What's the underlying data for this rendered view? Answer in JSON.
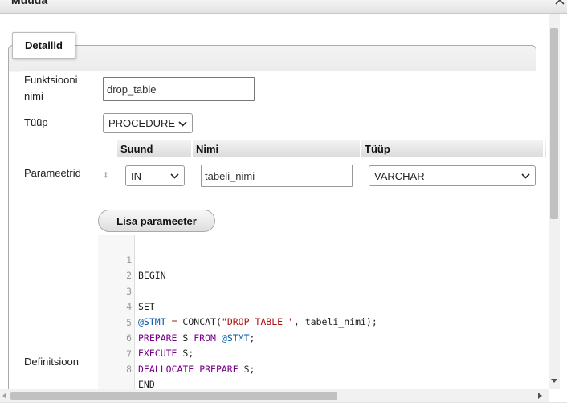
{
  "dialog": {
    "title": "Muuda"
  },
  "fieldset": {
    "legend": "Detailid"
  },
  "form": {
    "name_label_line1": "Funktsiooni",
    "name_label_line2": "nimi",
    "name_value": "drop_table",
    "type_label": "Tüüp",
    "type_value": "PROCEDURE",
    "params_label": "Parameetrid",
    "definition_label": "Definitsioon"
  },
  "params": {
    "headers": {
      "direction": "Suund",
      "name": "Nimi",
      "type": "Tüüp"
    },
    "rows": [
      {
        "direction": "IN",
        "name": "tabeli_nimi",
        "type": "VARCHAR"
      }
    ],
    "add_button": "Lisa parameeter"
  },
  "code": {
    "line_numbers": [
      "1",
      "2",
      "3",
      "4",
      "5",
      "6",
      "7",
      "8"
    ],
    "lines": [
      "BEGIN",
      "",
      "SET",
      "@STMT = CONCAT(\"DROP TABLE \", tabeli_nimi);",
      "PREPARE S FROM @STMT;",
      "EXECUTE S;",
      "DEALLOCATE PREPARE S;",
      "END"
    ]
  },
  "colors": {
    "keyword": "#770088",
    "variable": "#0055aa",
    "string": "#aa1111"
  },
  "icons": {
    "close": "chevron-up-icon",
    "drag": "drag-handle-icon",
    "caret": "chevron-down-icon"
  }
}
